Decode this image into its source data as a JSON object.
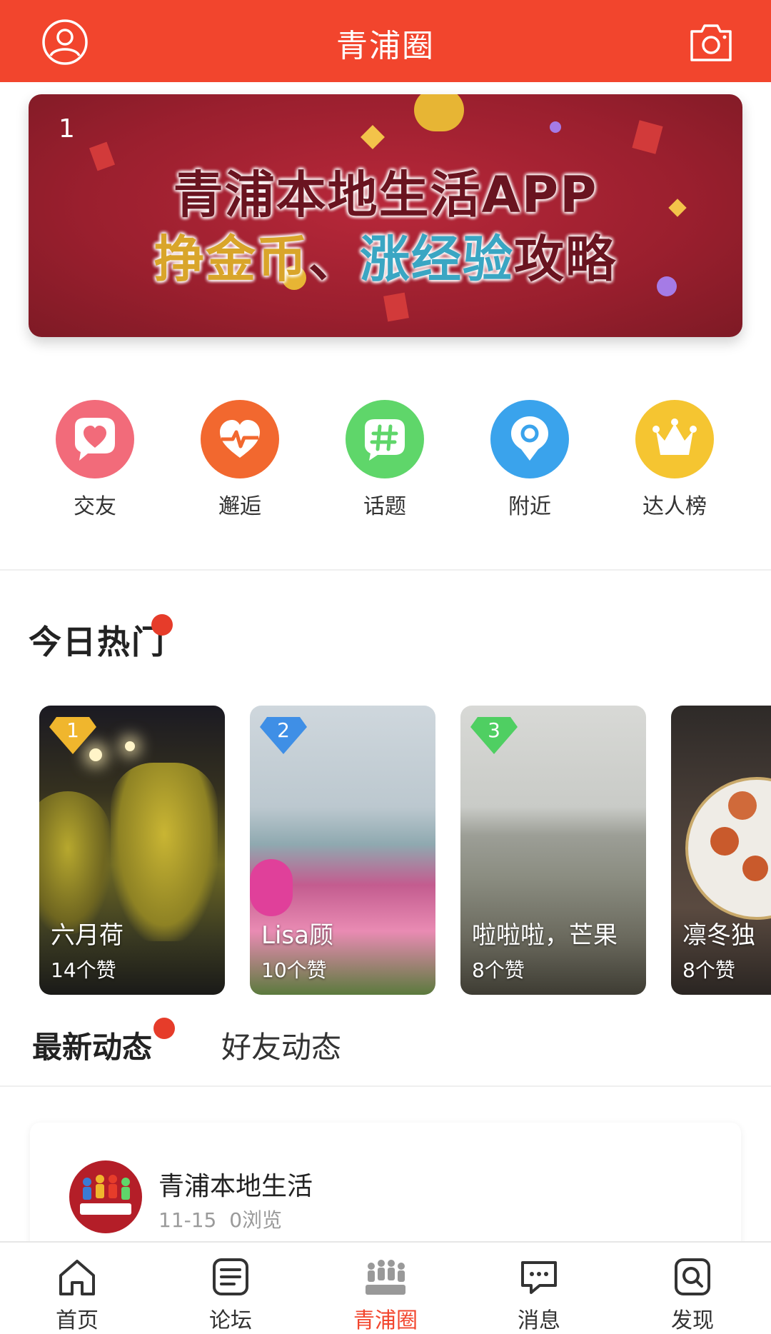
{
  "header": {
    "title": "青浦圈",
    "profile_icon": "user-circle-icon",
    "camera_icon": "camera-icon",
    "bg_color": "#f2452d"
  },
  "banner": {
    "index": "1",
    "line1": "青浦本地生活APP",
    "line2_part1": "挣金币",
    "line2_sep": "、",
    "line2_part2": "涨经验",
    "line2_part3": "攻略"
  },
  "quick_entries": [
    {
      "label": "交友",
      "icon": "heart-icon",
      "color": "#f26b7a"
    },
    {
      "label": "邂逅",
      "icon": "heartbeat-icon",
      "color": "#f2682f"
    },
    {
      "label": "话题",
      "icon": "hashtag-icon",
      "color": "#5fd66a"
    },
    {
      "label": "附近",
      "icon": "location-pin-icon",
      "color": "#3aa3ec"
    },
    {
      "label": "达人榜",
      "icon": "crown-icon",
      "color": "#f5c531"
    }
  ],
  "hot": {
    "title": "今日热门",
    "cards": [
      {
        "rank": "1",
        "name": "六月荷",
        "likes": "14个赞"
      },
      {
        "rank": "2",
        "name": "Lisa顾",
        "likes": "10个赞"
      },
      {
        "rank": "3",
        "name": "啦啦啦，芒果",
        "likes": "8个赞"
      },
      {
        "rank": "",
        "name": "凛冬独",
        "likes": "8个赞"
      }
    ]
  },
  "feed": {
    "tab_latest": "最新动态",
    "tab_friends": "好友动态",
    "post": {
      "author": "青浦本地生活",
      "date": "11-15",
      "views": "0浏览",
      "avatar_text": "青浦本地生活"
    }
  },
  "tabbar": {
    "items": [
      {
        "label": "首页",
        "icon": "home-icon"
      },
      {
        "label": "论坛",
        "icon": "forum-icon"
      },
      {
        "label": "青浦圈",
        "icon": "community-icon"
      },
      {
        "label": "消息",
        "icon": "message-icon"
      },
      {
        "label": "发现",
        "icon": "discover-icon"
      }
    ],
    "active_color": "#f2452d"
  }
}
